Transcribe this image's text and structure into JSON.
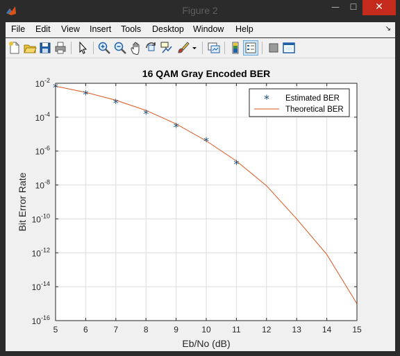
{
  "window": {
    "title": "Figure 2",
    "min_glyph": "—",
    "max_glyph": "☐",
    "close_glyph": "✕"
  },
  "menu": {
    "items": [
      "File",
      "Edit",
      "View",
      "Insert",
      "Tools",
      "Desktop",
      "Window",
      "Help"
    ],
    "dock_glyph": "↘"
  },
  "toolbar": {
    "icons": [
      "new-figure-icon",
      "open-file-icon",
      "save-icon",
      "print-icon",
      "edit-plot-arrow-icon",
      "zoom-in-icon",
      "zoom-out-icon",
      "pan-hand-icon",
      "rotate-3d-icon",
      "data-cursor-icon",
      "brush-icon",
      "brush-dropdown-icon",
      "link-plot-icon",
      "insert-colorbar-icon",
      "insert-legend-icon",
      "hide-plot-tools-icon",
      "show-plot-tools-icon"
    ],
    "colors": {
      "blue": "#1f5fa8",
      "red": "#c0392b",
      "yellow": "#e8c23a",
      "green": "#3a8f3a"
    }
  },
  "chart_data": {
    "type": "line",
    "title": "16 QAM Gray Encoded BER",
    "xlabel": "Eb/No (dB)",
    "ylabel": "Bit Error Rate",
    "xlim": [
      5,
      15
    ],
    "ylim_exponent": [
      -16,
      -2
    ],
    "yscale": "log",
    "grid": true,
    "x_ticks": [
      "5",
      "6",
      "7",
      "8",
      "9",
      "10",
      "11",
      "12",
      "13",
      "14",
      "15"
    ],
    "y_ticks": [
      {
        "base": "10",
        "exp": "-2"
      },
      {
        "base": "10",
        "exp": "-4"
      },
      {
        "base": "10",
        "exp": "-6"
      },
      {
        "base": "10",
        "exp": "-8"
      },
      {
        "base": "10",
        "exp": "-10"
      },
      {
        "base": "10",
        "exp": "-12"
      },
      {
        "base": "10",
        "exp": "-14"
      },
      {
        "base": "10",
        "exp": "-16"
      }
    ],
    "legend_position": "top-right",
    "series": [
      {
        "name": "Estimated BER",
        "marker": "*",
        "color": "#1a4f7a",
        "x": [
          5,
          6,
          7,
          8,
          9,
          10,
          11
        ],
        "y": [
          0.0066,
          0.0026,
          0.0008,
          0.00018,
          3.1e-05,
          4.5e-06,
          2e-07
        ]
      },
      {
        "name": "Theoretical BER",
        "marker": "line",
        "color": "#d95319",
        "x": [
          5,
          6,
          7,
          8,
          9,
          10,
          11,
          12,
          13,
          14,
          15
        ],
        "y": [
          0.0067,
          0.0029,
          0.001,
          0.00025,
          4e-05,
          4e-06,
          2.6e-07,
          9e-09,
          1e-10,
          8e-13,
          1e-15
        ]
      }
    ]
  }
}
